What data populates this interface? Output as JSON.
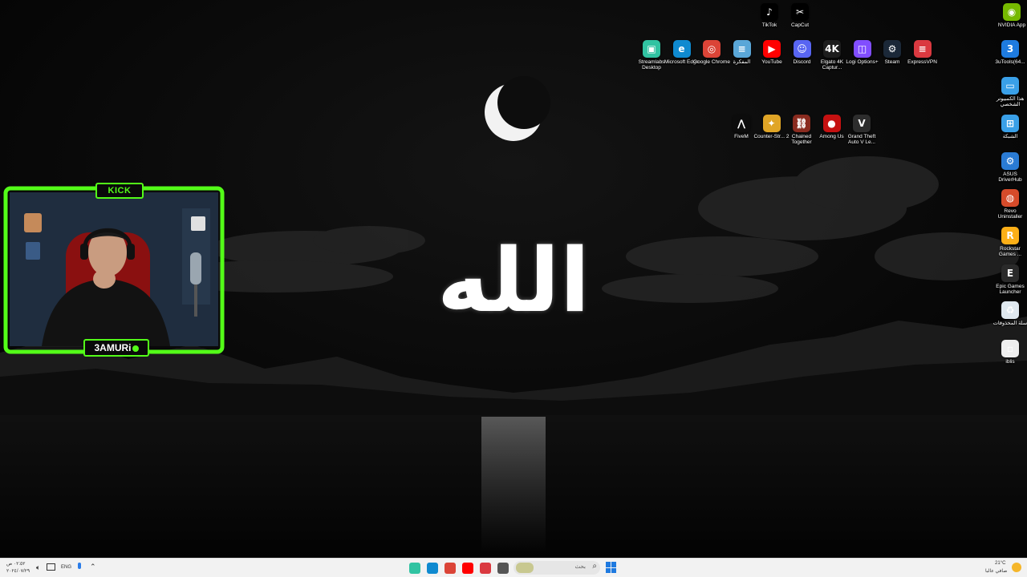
{
  "desktop": {
    "top_icons": [
      {
        "label": "TikTok",
        "icon": "tiktok-icon",
        "color": "#000000",
        "glyph": "♪"
      },
      {
        "label": "CapCut",
        "icon": "capcut-icon",
        "color": "#000000",
        "glyph": "✂"
      },
      {
        "label": "NVIDIA App",
        "icon": "nvidia-icon",
        "color": "#76b900",
        "glyph": "◉"
      }
    ],
    "row_icons": [
      {
        "label": "Streamlabs Desktop",
        "icon": "streamlabs-icon",
        "color": "#31c3a2",
        "glyph": "▣"
      },
      {
        "label": "Microsoft Edge",
        "icon": "edge-icon",
        "color": "#0f8ad0",
        "glyph": "e"
      },
      {
        "label": "Google Chrome",
        "icon": "chrome-icon",
        "color": "#db4437",
        "glyph": "◎"
      },
      {
        "label": "المفكرة",
        "icon": "notepad-icon",
        "color": "#5aa7d8",
        "glyph": "≡"
      },
      {
        "label": "YouTube",
        "icon": "youtube-icon",
        "color": "#ff0000",
        "glyph": "▶"
      },
      {
        "label": "Discord",
        "icon": "discord-icon",
        "color": "#5865f2",
        "glyph": "☺"
      },
      {
        "label": "Elgato 4K Captur...",
        "icon": "elgato-icon",
        "color": "#1d1d1d",
        "glyph": "4K"
      },
      {
        "label": "Logi Options+",
        "icon": "logi-icon",
        "color": "#814eff",
        "glyph": "◫"
      },
      {
        "label": "Steam",
        "icon": "steam-icon",
        "color": "#1b2838",
        "glyph": "⚙"
      },
      {
        "label": "ExpressVPN",
        "icon": "expressvpn-icon",
        "color": "#da3940",
        "glyph": "≡"
      }
    ],
    "game_icons": [
      {
        "label": "FiveM",
        "icon": "fivem-icon",
        "color": "#0c0c0c",
        "glyph": "⋀"
      },
      {
        "label": "Counter-Str... 2",
        "icon": "cs2-icon",
        "color": "#e0a526",
        "glyph": "✦"
      },
      {
        "label": "Chained Together",
        "icon": "chained-together-icon",
        "color": "#8a2b1f",
        "glyph": "⛓"
      },
      {
        "label": "Among Us",
        "icon": "among-us-icon",
        "color": "#c51111",
        "glyph": "●"
      },
      {
        "label": "Grand Theft Auto V Le...",
        "icon": "gta-icon",
        "color": "#2d2d2d",
        "glyph": "V"
      }
    ],
    "right_icons": [
      {
        "label": "3uTools(64...",
        "icon": "3utools-icon",
        "color": "#1e7be0",
        "glyph": "3"
      },
      {
        "label": "هذا الكمبيوتر الشخصي",
        "icon": "this-pc-icon",
        "color": "#3aa0e8",
        "glyph": "▭"
      },
      {
        "label": "الشبكة",
        "icon": "network-icon",
        "color": "#3aa0e8",
        "glyph": "⊞"
      },
      {
        "label": "ASUS DriverHub",
        "icon": "asus-driverhub-icon",
        "color": "#2a7bd4",
        "glyph": "⚙"
      },
      {
        "label": "Revo Uninstaller",
        "icon": "revo-icon",
        "color": "#d64b2a",
        "glyph": "◍"
      },
      {
        "label": "Rockstar Games ...",
        "icon": "rockstar-icon",
        "color": "#fcaf17",
        "glyph": "R"
      },
      {
        "label": "Epic Games Launcher",
        "icon": "epic-games-icon",
        "color": "#2a2a2a",
        "glyph": "E"
      },
      {
        "label": "سلة المحذوفات",
        "icon": "recycle-bin-icon",
        "color": "#dfe8ef",
        "glyph": "♻"
      },
      {
        "label": "iblis",
        "icon": "file-icon",
        "color": "#eeeeee",
        "glyph": "▫"
      }
    ]
  },
  "overlay": {
    "platform": "KICK",
    "streamer": "3AMURi",
    "accent": "#53fc18"
  },
  "wallpaper": {
    "calligraphy": "الله"
  },
  "taskbar": {
    "search_placeholder": "بحث",
    "clock_time": "٠٢:٥٢ ص",
    "clock_date": "٢٠٢٤/٠٧/٢٩",
    "language": "ENG",
    "weather_temp": "21°C",
    "weather_desc": "صافي عالبا",
    "apps": [
      {
        "name": "streamlabs",
        "color": "#31c3a2"
      },
      {
        "name": "edge",
        "color": "#0f8ad0"
      },
      {
        "name": "chrome",
        "color": "#db4437"
      },
      {
        "name": "youtube",
        "color": "#ff0000"
      },
      {
        "name": "expressvpn",
        "color": "#da3940"
      },
      {
        "name": "explorer",
        "color": "#555555"
      }
    ]
  }
}
